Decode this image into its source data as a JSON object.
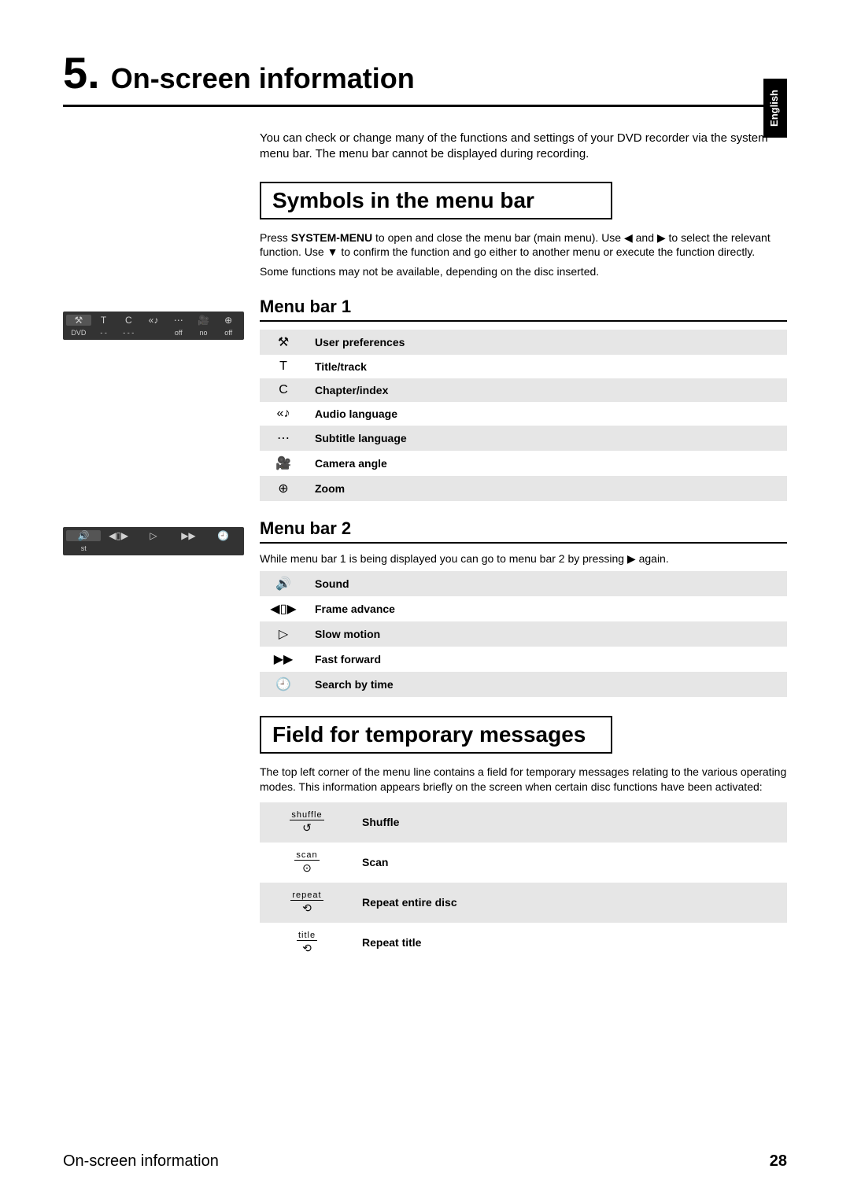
{
  "chapter": {
    "number": "5.",
    "title": "On-screen information"
  },
  "lang_tab": "English",
  "intro": "You can check or change many of the functions and settings of your DVD recorder via the system menu bar. The menu bar cannot be displayed during recording.",
  "section1": {
    "title": "Symbols in the menu bar",
    "p1_a": "Press ",
    "p1_b": "SYSTEM-MENU",
    "p1_c": " to open and close the menu bar (main menu). Use ◀ and ▶ to select the relevant function. Use ▼ to confirm the function and go either to another menu or execute the function directly.",
    "p2": "Some functions may not be available, depending on the disc inserted."
  },
  "menubar1": {
    "heading": "Menu bar 1",
    "rows": [
      {
        "icon": "⚒",
        "label": "User preferences"
      },
      {
        "icon": "T",
        "label": "Title/track"
      },
      {
        "icon": "C",
        "label": "Chapter/index"
      },
      {
        "icon": "«♪",
        "label": "Audio language"
      },
      {
        "icon": "⋯",
        "label": "Subtitle language"
      },
      {
        "icon": "🎥",
        "label": "Camera angle"
      },
      {
        "icon": "⊕",
        "label": "Zoom"
      }
    ],
    "osd_row1": [
      "⚒",
      "T",
      "C",
      "«♪",
      "⋯",
      "🎥",
      "⊕"
    ],
    "osd_row2": [
      "DVD",
      "- -",
      "- - -",
      "",
      "off",
      "no",
      "off"
    ]
  },
  "menubar2": {
    "heading": "Menu bar 2",
    "intro": "While menu bar 1 is being displayed you can go to menu bar 2 by pressing ▶ again.",
    "rows": [
      {
        "icon": "🔊",
        "label": "Sound"
      },
      {
        "icon": "◀▯▶",
        "label": "Frame advance"
      },
      {
        "icon": "▷",
        "label": "Slow motion"
      },
      {
        "icon": "▶▶",
        "label": "Fast forward"
      },
      {
        "icon": "🕘",
        "label": "Search by time"
      }
    ],
    "osd_row1": [
      "🔊",
      "◀▯▶",
      "▷",
      "▶▶",
      "🕘"
    ],
    "osd_row2": [
      "st",
      "",
      "",
      "",
      ""
    ]
  },
  "section2": {
    "title": "Field for temporary messages",
    "p": "The top left corner of the menu line contains a field for temporary messages relating to the various operating modes. This information appears briefly on the screen when certain disc functions have been activated:",
    "rows": [
      {
        "small": "shuffle",
        "glyph": "↺",
        "label": "Shuffle"
      },
      {
        "small": "scan",
        "glyph": "⊙",
        "label": "Scan"
      },
      {
        "small": "repeat",
        "glyph": "⟲",
        "label": "Repeat entire disc"
      },
      {
        "small": "title",
        "glyph": "⟲",
        "label": "Repeat title"
      }
    ]
  },
  "footer": {
    "left": "On-screen information",
    "right": "28"
  }
}
